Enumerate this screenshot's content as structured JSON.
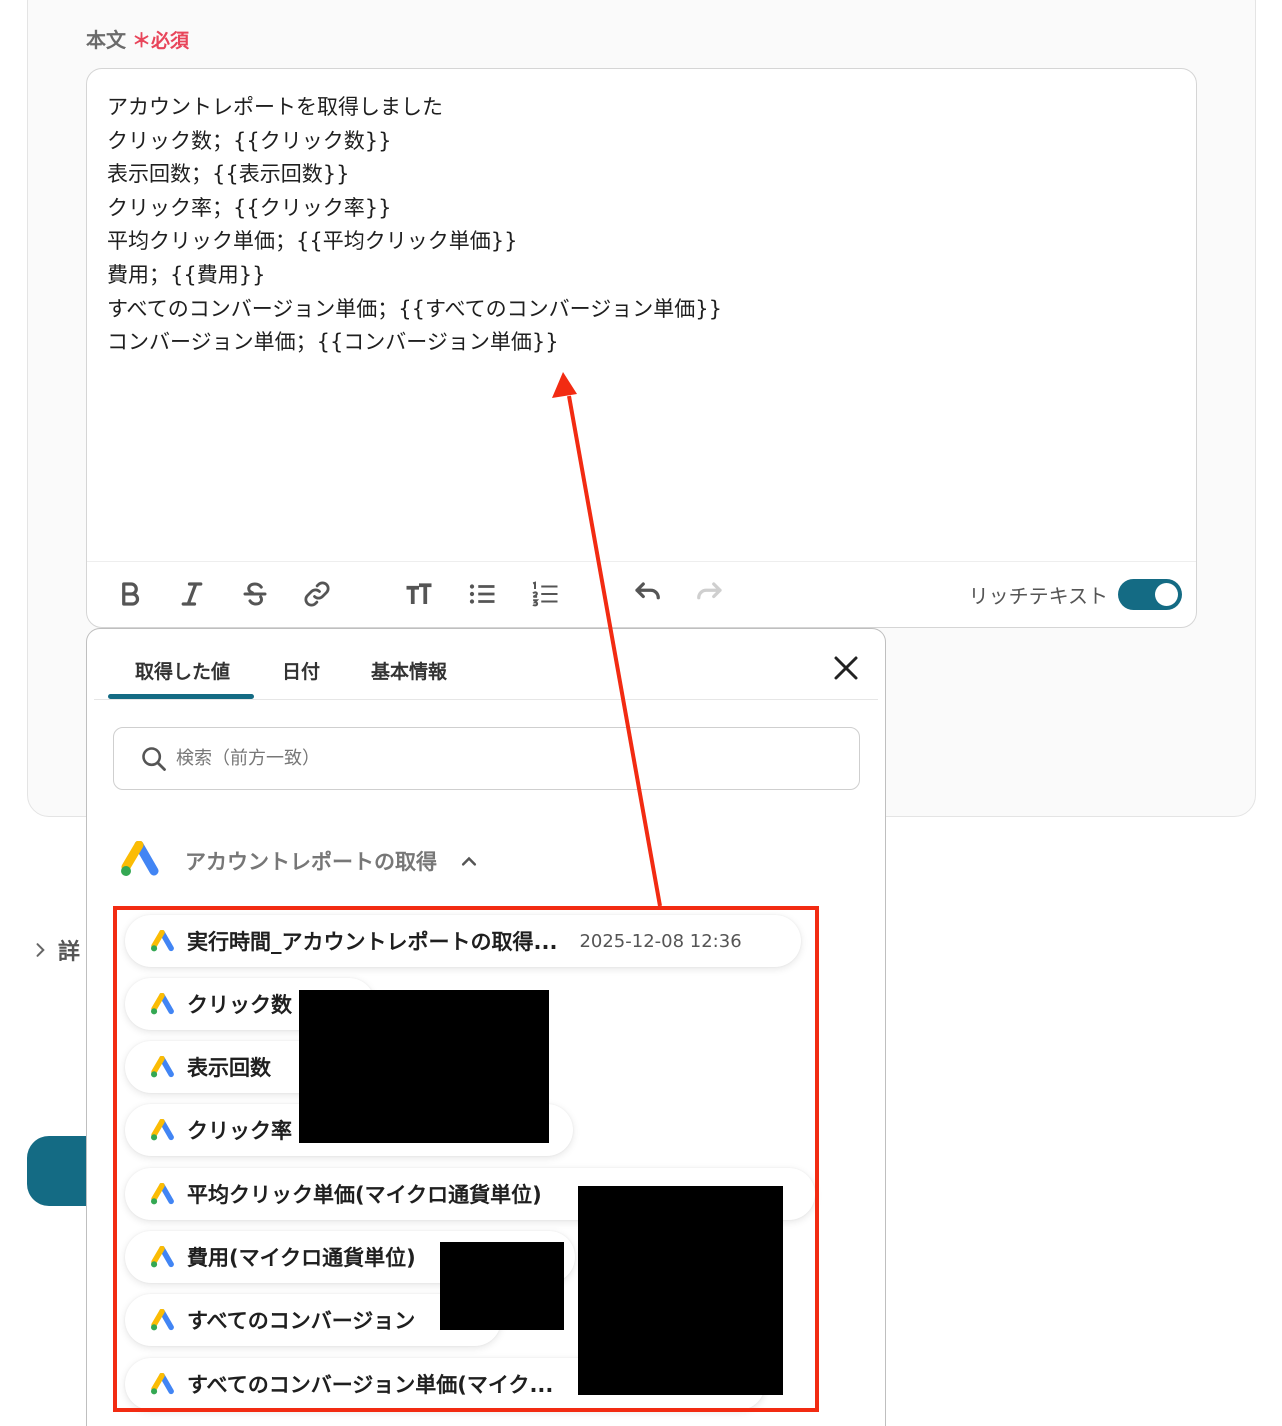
{
  "form": {
    "label": "本文",
    "required_mark": "＊",
    "required_text": "必須",
    "body_text": "アカウントレポートを取得しました\nクリック数；{{クリック数}}\n表示回数；{{表示回数}}\nクリック率；{{クリック率}}\n平均クリック単価；{{平均クリック単価}}\n費用；{{費用}}\nすべてのコンバージョン単価；{{すべてのコンバージョン単価}}\nコンバージョン単価；{{コンバージョン単価}}",
    "toolbar": {
      "buttons": [
        "bold-icon",
        "italic-icon",
        "strikethrough-icon",
        "link-icon",
        "text-size-icon",
        "bullet-list-icon",
        "numbered-list-icon",
        "undo-icon",
        "redo-icon"
      ],
      "rich_text_label": "リッチテキスト",
      "rich_text_enabled": true
    }
  },
  "details_label": "詳",
  "popup": {
    "tabs": [
      "取得した値",
      "日付",
      "基本情報"
    ],
    "active_tab": "取得した値",
    "search_placeholder": "検索（前方一致）",
    "group": {
      "title": "アカウントレポートの取得",
      "items": [
        {
          "name": "実行時間_アカウントレポートの取得...",
          "value": "2025-12-08 12:36"
        },
        {
          "name": "クリック数",
          "value": ""
        },
        {
          "name": "表示回数",
          "value": ""
        },
        {
          "name": "クリック率",
          "value": ""
        },
        {
          "name": "平均クリック単価(マイクロ通貨単位)",
          "value": ""
        },
        {
          "name": "費用(マイクロ通貨単位)",
          "value": ""
        },
        {
          "name": "すべてのコンバージョン",
          "value": ""
        },
        {
          "name": "すべてのコンバージョン単価(マイク...",
          "value": ""
        }
      ]
    }
  },
  "colors": {
    "accent": "#146b84",
    "required": "#e8455a",
    "annotation": "#f22b12"
  }
}
